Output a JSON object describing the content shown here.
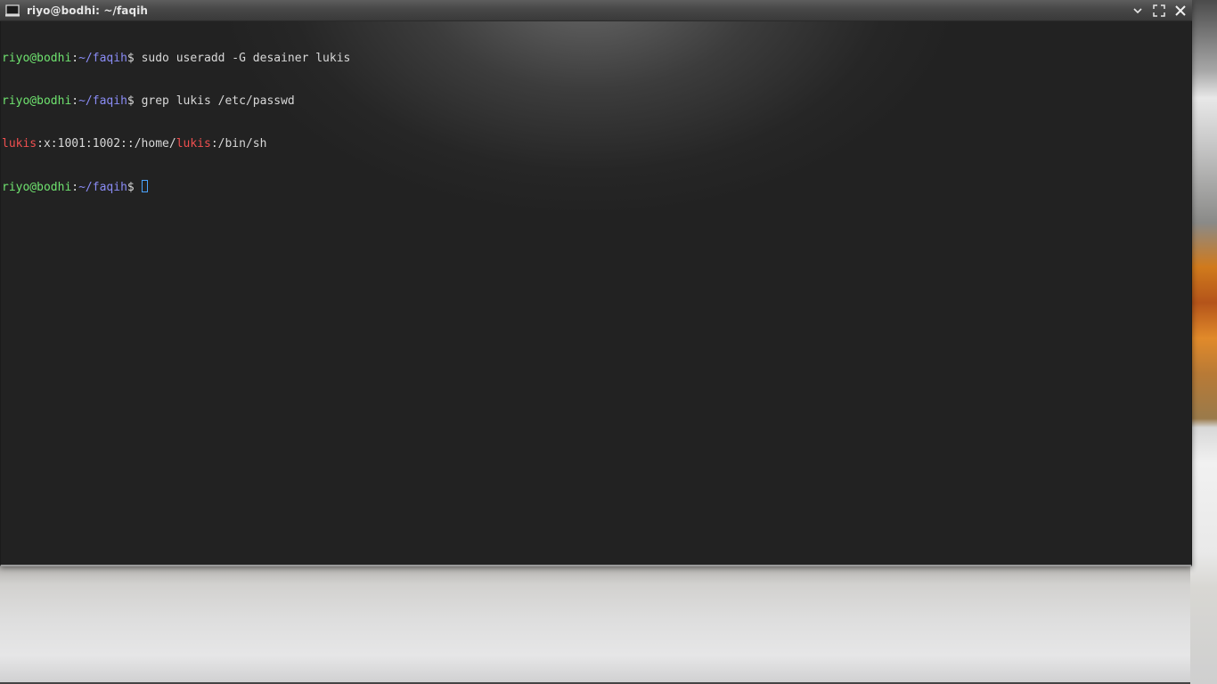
{
  "window": {
    "title": "riyo@bodhi: ~/faqih",
    "icon": "terminal-icon",
    "buttons": [
      "minimize-chevron-icon",
      "maximize-icon",
      "close-icon"
    ]
  },
  "prompt": {
    "user_host": "riyo@bodhi",
    "colon": ":",
    "path": "~/faqih",
    "dollar": "$ "
  },
  "lines": {
    "line1_cmd": "sudo useradd -G desainer lukis",
    "line2_cmd": "grep lukis /etc/passwd",
    "line3_out": [
      {
        "text": "lukis",
        "color": "#ef4f4f"
      },
      {
        "text": ":x:1001:1002::/home/",
        "color": "#d8d8d8"
      },
      {
        "text": "lukis",
        "color": "#ef4f4f"
      },
      {
        "text": ":/bin/sh",
        "color": "#d8d8d8"
      }
    ]
  },
  "colors": {
    "prompt_user": "#6fe36f",
    "prompt_path": "#8a8cf5",
    "match_highlight": "#ef4f4f",
    "terminal_bg": "#222222",
    "cursor": "#4aa3ff"
  }
}
